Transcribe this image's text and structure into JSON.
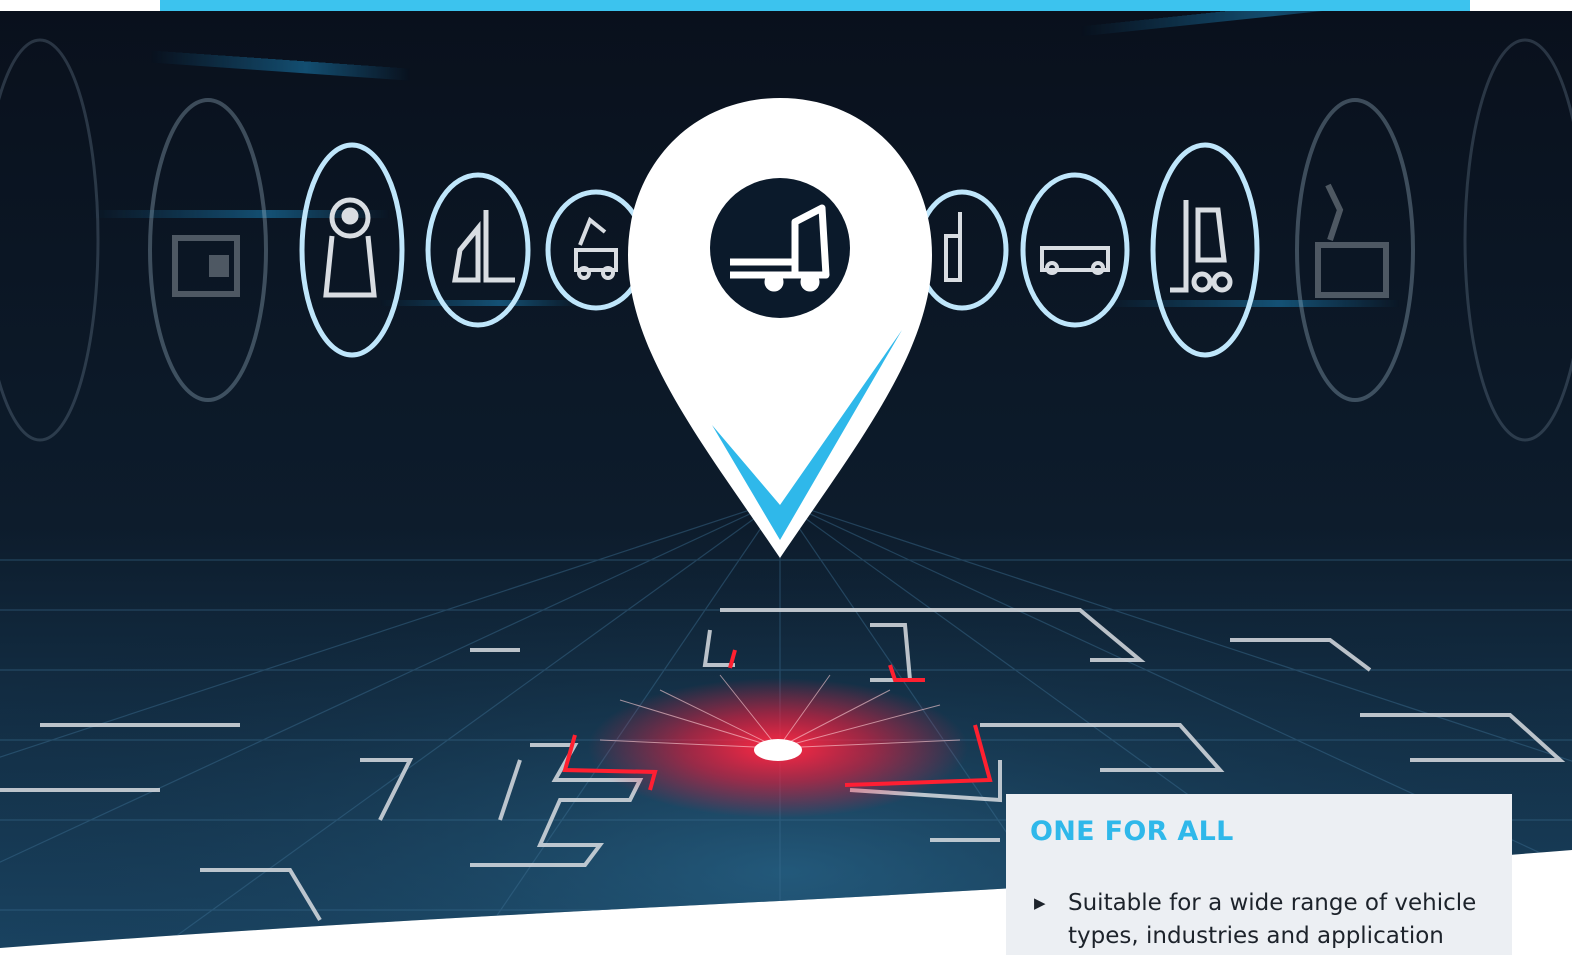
{
  "card": {
    "title": "ONE FOR ALL",
    "bullets": [
      "Suitable for a wide range of vehicle types, industries and application"
    ]
  },
  "icons": [
    "container-icon",
    "robot-icon",
    "forklift-icon",
    "robot-arm-cart-icon",
    "truck-icon",
    "stacker-icon",
    "flatbed-cart-icon",
    "forklift-icon",
    "robot-arm-cart-icon"
  ],
  "colors": {
    "accent": "#3cc3ee",
    "background": "#0b1a2b",
    "laser": "#ff1a3a"
  }
}
